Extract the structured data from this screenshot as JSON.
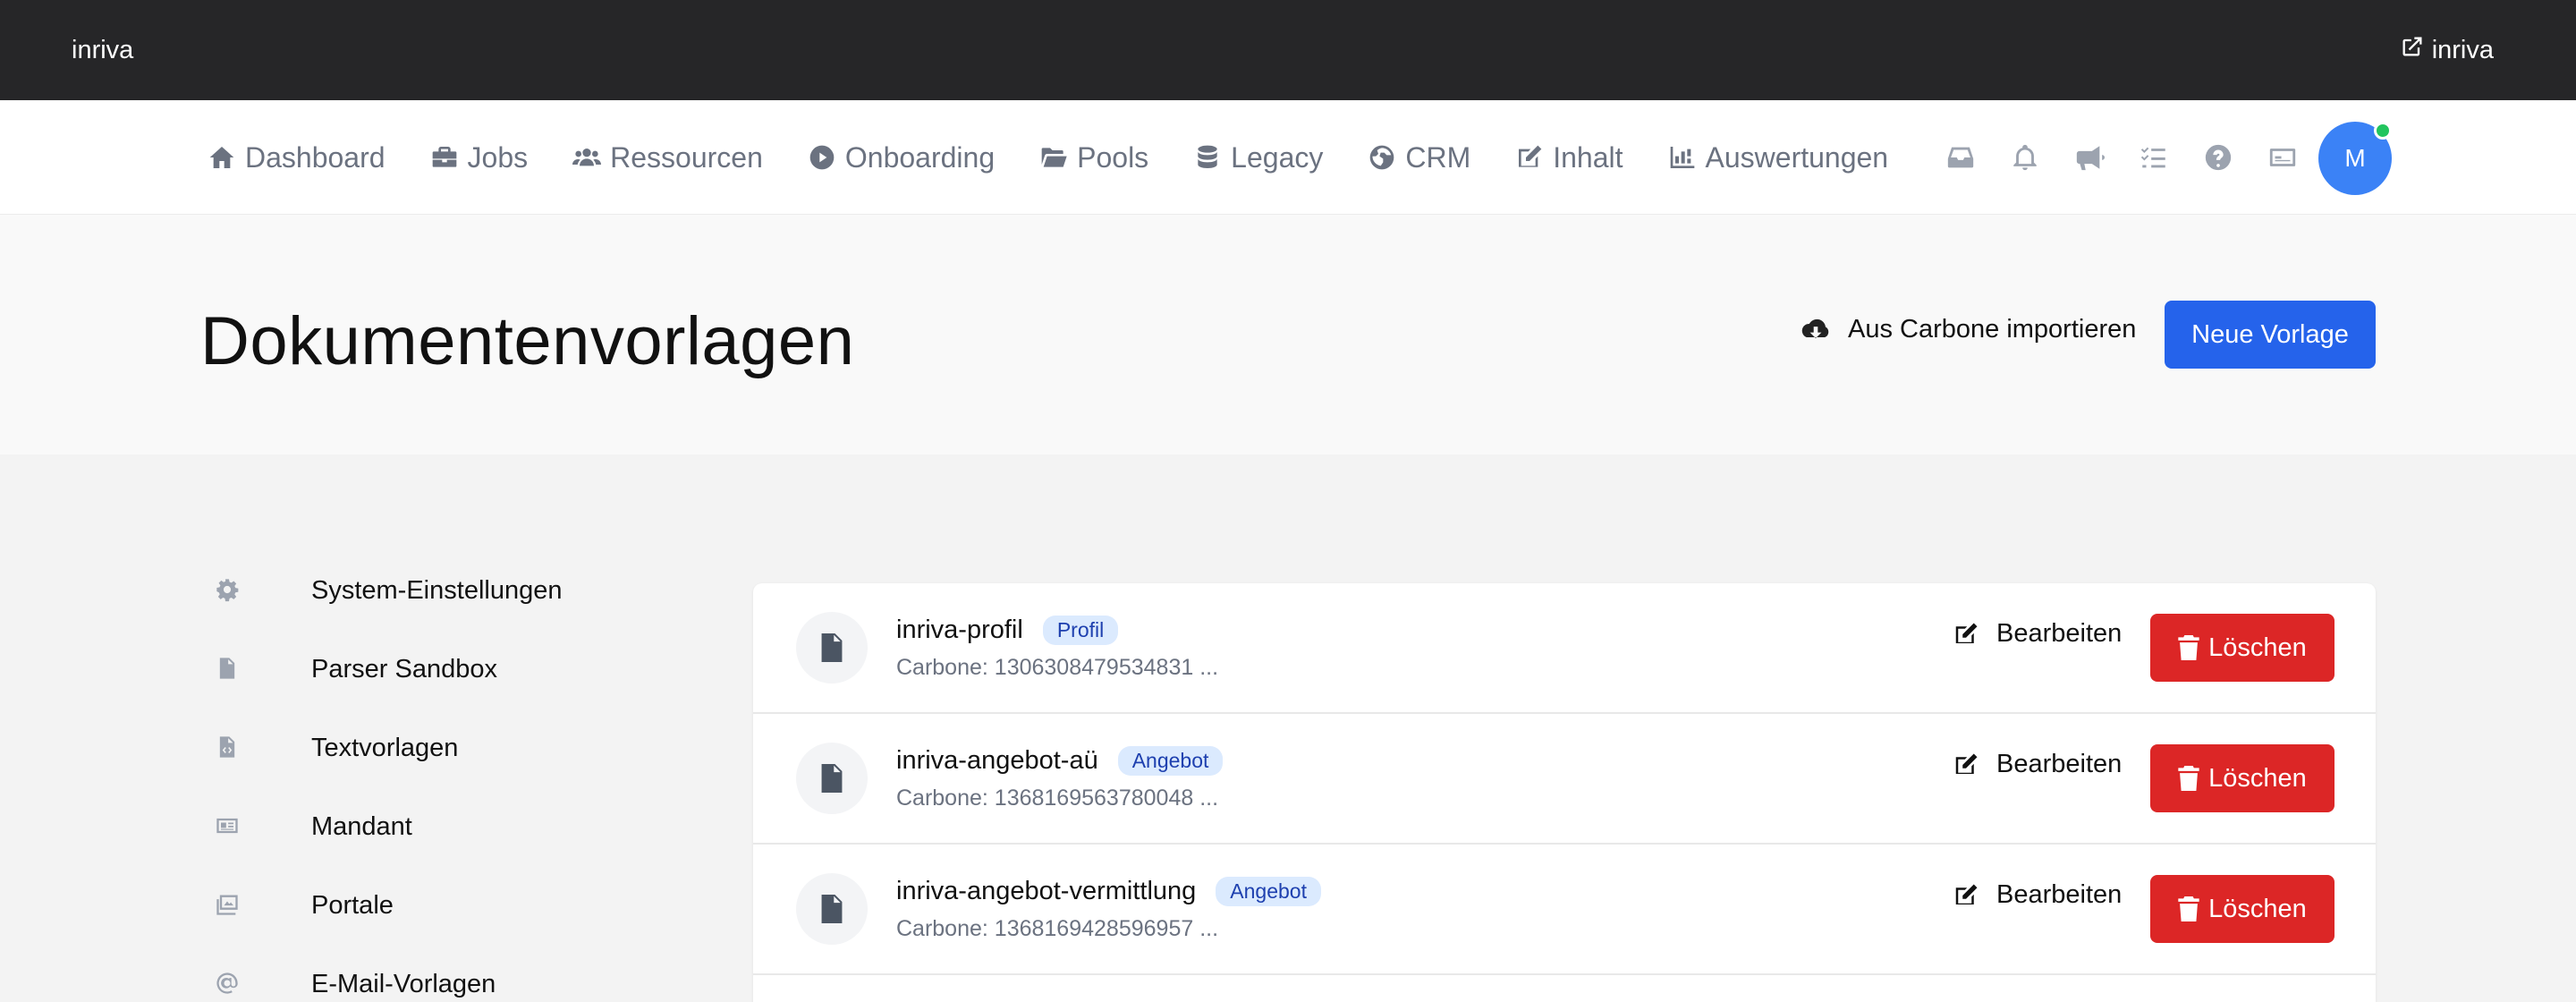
{
  "topbar": {
    "brand": "inriva",
    "external_link": "inriva"
  },
  "nav": {
    "items": [
      {
        "label": "Dashboard",
        "icon": "home-icon"
      },
      {
        "label": "Jobs",
        "icon": "briefcase-icon"
      },
      {
        "label": "Ressourcen",
        "icon": "users-icon"
      },
      {
        "label": "Onboarding",
        "icon": "play-circle-icon"
      },
      {
        "label": "Pools",
        "icon": "folder-open-icon"
      },
      {
        "label": "Legacy",
        "icon": "database-icon"
      },
      {
        "label": "CRM",
        "icon": "globe-icon"
      },
      {
        "label": "Inhalt",
        "icon": "edit-icon"
      },
      {
        "label": "Auswertungen",
        "icon": "chart-icon"
      }
    ],
    "icons": [
      "inbox-icon",
      "bell-icon",
      "megaphone-icon",
      "tasks-icon",
      "help-icon",
      "id-card-icon"
    ],
    "avatar_initial": "M"
  },
  "header": {
    "title": "Dokumentenvorlagen",
    "import_label": "Aus Carbone importieren",
    "new_label": "Neue Vorlage"
  },
  "sidebar": {
    "items": [
      {
        "label": "System-Einstellungen",
        "icon": "gear-icon"
      },
      {
        "label": "Parser Sandbox",
        "icon": "file-icon"
      },
      {
        "label": "Textvorlagen",
        "icon": "file-code-icon"
      },
      {
        "label": "Mandant",
        "icon": "id-card-icon"
      },
      {
        "label": "Portale",
        "icon": "images-icon"
      },
      {
        "label": "E-Mail-Vorlagen",
        "icon": "at-icon"
      }
    ]
  },
  "templates": {
    "edit_label": "Bearbeiten",
    "delete_label": "Löschen",
    "rows": [
      {
        "name": "inriva-profil",
        "badge": "Profil",
        "meta": "Carbone: 1306308479534831 ..."
      },
      {
        "name": "inriva-angebot-aü",
        "badge": "Angebot",
        "meta": "Carbone: 1368169563780048 ..."
      },
      {
        "name": "inriva-angebot-vermittlung",
        "badge": "Angebot",
        "meta": "Carbone: 1368169428596957 ..."
      }
    ]
  },
  "colors": {
    "primary": "#2563eb",
    "danger": "#dc2626",
    "topbar": "#262628",
    "online": "#22c55e"
  }
}
